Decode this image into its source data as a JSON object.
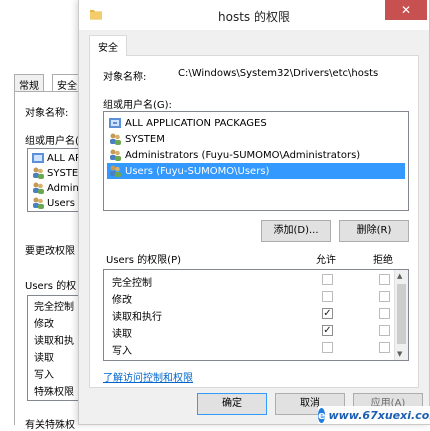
{
  "background_dialog": {
    "tabs": [
      "常规",
      "安全"
    ],
    "object_label": "对象名称:",
    "group_label": "组或用户名(",
    "list_items": [
      "ALL AP",
      "SYSTEM",
      "Admini",
      "Users ("
    ],
    "change_text": "要更改权限",
    "perms_label": "Users 的权",
    "perm_items": [
      "完全控制",
      "修改",
      "读取和执",
      "读取",
      "写入",
      "特殊权限"
    ],
    "footer_text": "有关特殊权"
  },
  "dialog": {
    "title": "hosts 的权限",
    "tab": "安全",
    "object_label": "对象名称:",
    "object_value": "C:\\Windows\\System32\\Drivers\\etc\\hosts",
    "group_label": "组或用户名(G):",
    "groups": [
      {
        "name": "ALL APPLICATION PACKAGES",
        "icon": "package-icon"
      },
      {
        "name": "SYSTEM",
        "icon": "users-icon"
      },
      {
        "name": "Administrators (Fuyu-SUMOMO\\Administrators)",
        "icon": "users-icon"
      },
      {
        "name": "Users (Fuyu-SUMOMO\\Users)",
        "icon": "users-icon"
      }
    ],
    "selected_group_index": 3,
    "add_button": "添加(D)...",
    "remove_button": "删除(R)",
    "perms_header": "Users 的权限(P)",
    "allow_header": "允许",
    "deny_header": "拒绝",
    "permissions": [
      {
        "name": "完全控制",
        "allow": "",
        "deny": ""
      },
      {
        "name": "修改",
        "allow": "",
        "deny": ""
      },
      {
        "name": "读取和执行",
        "allow": "✓",
        "deny": ""
      },
      {
        "name": "读取",
        "allow": "✓",
        "deny": ""
      },
      {
        "name": "写入",
        "allow": "",
        "deny": ""
      }
    ],
    "link": "了解访问控制和权限",
    "ok_button": "确定",
    "cancel_button": "取消",
    "apply_button": "应用(A)"
  },
  "watermark": {
    "letter": "e",
    "text": "www.67xuexi.com"
  },
  "colors": {
    "selection": "#3399ff",
    "close": "#c75050",
    "link": "#0066cc"
  }
}
